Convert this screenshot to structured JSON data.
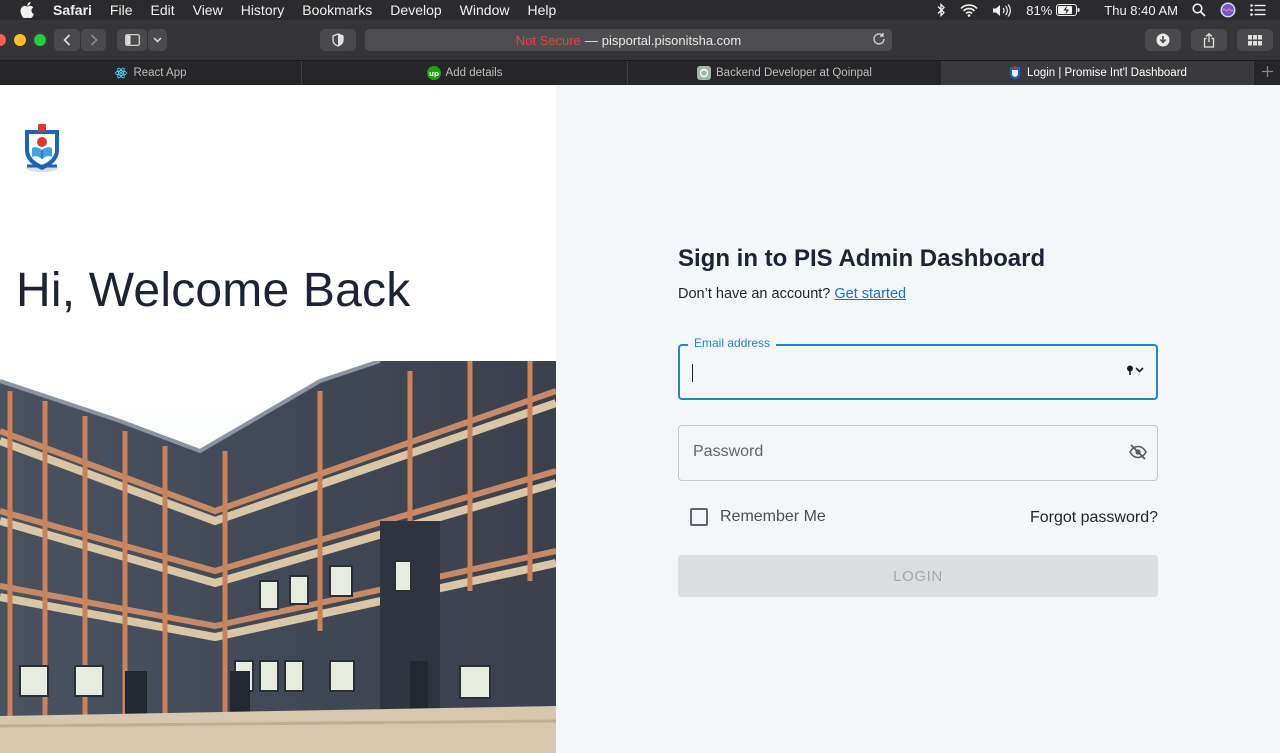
{
  "menubar": {
    "app_name": "Safari",
    "items": [
      "File",
      "Edit",
      "View",
      "History",
      "Bookmarks",
      "Develop",
      "Window",
      "Help"
    ],
    "battery": "81%",
    "clock": "Thu 8:40 AM"
  },
  "toolbar": {
    "not_secure": "Not Secure",
    "separator": "—",
    "url": "pisportal.pisonitsha.com"
  },
  "tabs": [
    {
      "label": "React App",
      "icon": "react-favicon"
    },
    {
      "label": "Add details",
      "icon": "upwork-favicon"
    },
    {
      "label": "Backend Developer at Qoinpal",
      "icon": "qoinpal-favicon"
    },
    {
      "label": "Login | Promise Int'l Dashboard",
      "icon": "school-favicon",
      "active": true
    }
  ],
  "left_panel": {
    "welcome": "Hi, Welcome Back"
  },
  "form": {
    "title": "Sign in to PIS Admin Dashboard",
    "subtitle": "Don’t have an account?",
    "get_started": "Get started",
    "email_label": "Email address",
    "email_value": "",
    "password_placeholder": "Password",
    "remember_label": "Remember Me",
    "forgot_label": "Forgot password?",
    "login_label": "LOGIN"
  },
  "colors": {
    "accent": "#1e88c8",
    "text": "#1c2434",
    "not_secure": "#e8403a"
  }
}
